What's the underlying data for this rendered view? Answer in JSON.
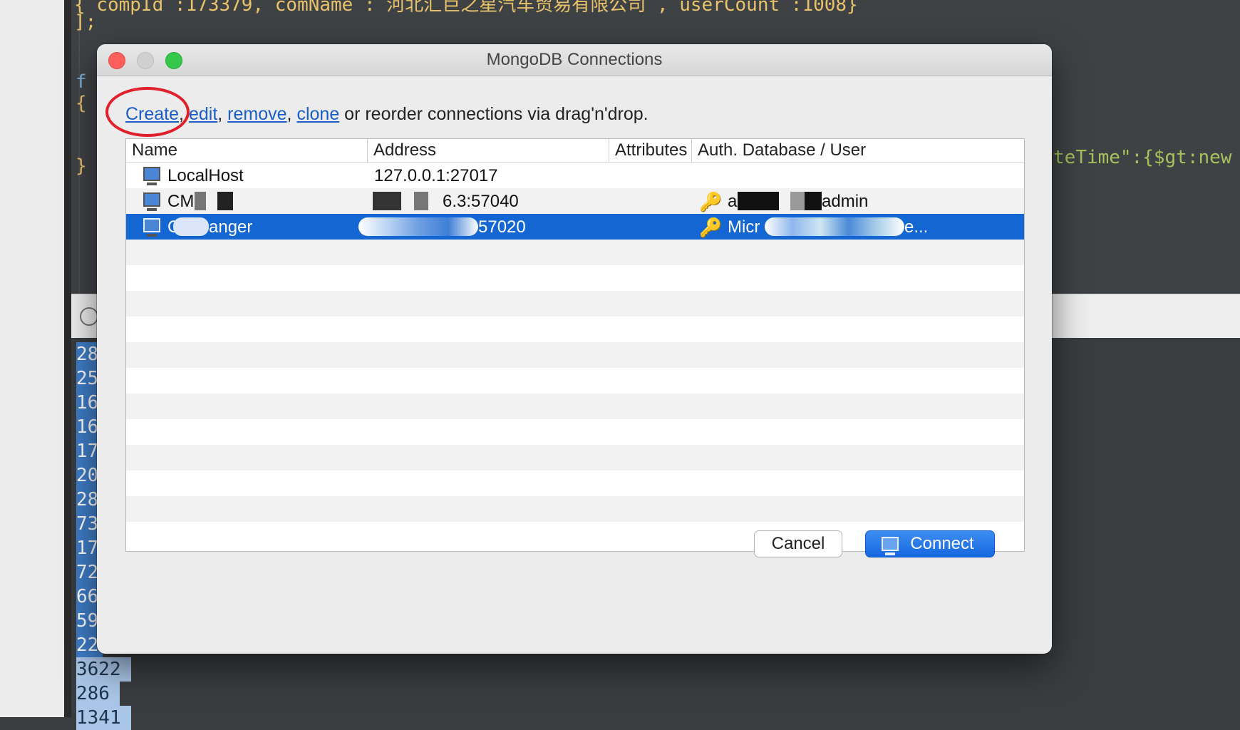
{
  "background": {
    "code_top": "{ compId :173379, comName : 河北汇巨之星汽车贸易有限公司 , userCount :1008}",
    "code_close": "];",
    "code_right": "teTime\":{$gt:new Da",
    "code_brace_open": "{",
    "code_brace_close": "}",
    "code_fragment": "f",
    "line_numbers": [
      "28",
      "25",
      "16",
      "16",
      "17",
      "20",
      "28",
      "73",
      "17",
      "72",
      "66",
      "59",
      "22",
      "3622",
      "286",
      "1341"
    ]
  },
  "dialog": {
    "title": "MongoDB Connections",
    "instructions": {
      "create": "Create",
      "edit": "edit",
      "remove": "remove",
      "clone": "clone",
      "sep1": ",",
      "sep2": ",",
      "sep3": ",",
      "rest": "or reorder connections via drag'n'drop."
    },
    "columns": {
      "name": "Name",
      "address": "Address",
      "attributes": "Attributes",
      "auth": "Auth. Database / User"
    },
    "rows": [
      {
        "name": "LocalHost",
        "address": "127.0.0.1:27017",
        "auth": ""
      },
      {
        "name": "CM",
        "address": "6.3:57040",
        "auth_prefix": "a",
        "auth": "admin"
      },
      {
        "name": "anger",
        "name_prefix": "C",
        "address": "57020",
        "auth": "Micr",
        "auth_suffix": "e..."
      }
    ],
    "buttons": {
      "cancel": "Cancel",
      "connect": "Connect"
    }
  },
  "colors": {
    "selection": "#1467d2",
    "link": "#1a5dc4",
    "annotation_circle": "#e0202a"
  }
}
